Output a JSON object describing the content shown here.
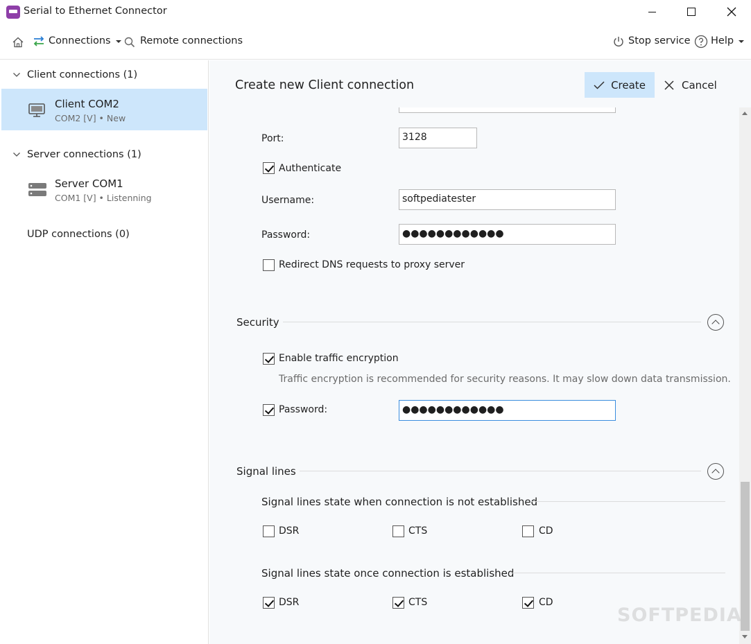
{
  "window": {
    "title": "Serial to Ethernet Connector"
  },
  "menubar": {
    "connections_label": "Connections",
    "remote_label": "Remote connections",
    "stop_label": "Stop service",
    "help_label": "Help"
  },
  "sidebar": {
    "groups": [
      {
        "label": "Client connections (1)"
      },
      {
        "label": "Server connections (1)"
      },
      {
        "label": "UDP connections (0)"
      }
    ],
    "items": [
      {
        "name": "Client COM2",
        "sub": "COM2 [V] • New"
      },
      {
        "name": "Server COM1",
        "sub": "COM1 [V] • Listenning"
      }
    ]
  },
  "main": {
    "title": "Create new Client connection",
    "create_label": "Create",
    "cancel_label": "Cancel",
    "proxy": {
      "port_label": "Port:",
      "port_value": "3128",
      "authenticate_label": "Authenticate",
      "authenticate_checked": true,
      "username_label": "Username:",
      "username_value": "softpediatester",
      "password_label": "Password:",
      "password_value": "●●●●●●●●●●●●",
      "redirect_dns_label": "Redirect DNS requests to proxy server",
      "redirect_dns_checked": false
    },
    "security": {
      "title": "Security",
      "encryption_label": "Enable traffic encryption",
      "encryption_checked": true,
      "hint": "Traffic encryption is recommended for security reasons. It may slow down data transmission.",
      "password_label": "Password:",
      "password_checked": true,
      "password_value": "●●●●●●●●●●●●"
    },
    "signal_lines": {
      "title": "Signal lines",
      "not_established_title": "Signal lines state when connection is not established",
      "established_title": "Signal lines state once connection is established",
      "not_established": [
        {
          "label": "DSR",
          "checked": false
        },
        {
          "label": "CTS",
          "checked": false
        },
        {
          "label": "CD",
          "checked": false
        }
      ],
      "established": [
        {
          "label": "DSR",
          "checked": true
        },
        {
          "label": "CTS",
          "checked": true
        },
        {
          "label": "CD",
          "checked": true
        }
      ]
    }
  },
  "watermark": "SOFTPEDIA",
  "colors": {
    "accent": "#cde6fb",
    "app_icon": "#8e3fa8",
    "focus_border": "#3a8dde"
  }
}
